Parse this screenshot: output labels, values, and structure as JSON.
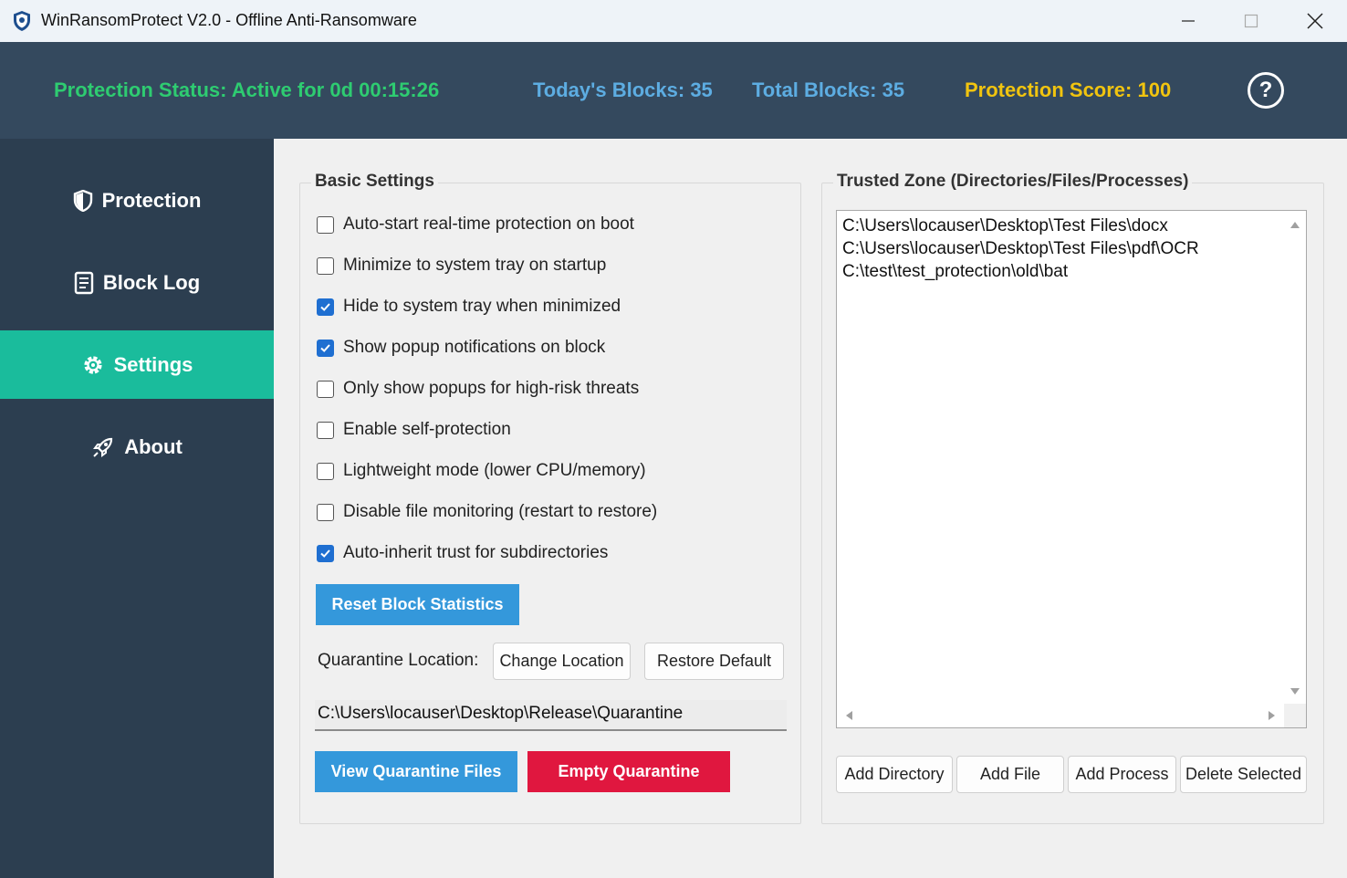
{
  "window": {
    "title": "WinRansomProtect V2.0 - Offline Anti-Ransomware"
  },
  "header": {
    "status": "Protection Status: Active for 0d 00:15:26",
    "today_blocks": "Today's Blocks: 35",
    "total_blocks": "Total Blocks: 35",
    "score": "Protection Score: 100",
    "help": "?",
    "colors": {
      "status": "#2ecc71",
      "blocks": "#5dade2",
      "score": "#f1c40f"
    }
  },
  "sidebar": {
    "items": [
      {
        "label": "Protection",
        "icon": "shield-icon",
        "active": false
      },
      {
        "label": "Block Log",
        "icon": "log-icon",
        "active": false
      },
      {
        "label": "Settings",
        "icon": "gear-icon",
        "active": true
      },
      {
        "label": "About",
        "icon": "rocket-icon",
        "active": false
      }
    ],
    "active_color": "#1abc9c"
  },
  "basic_settings": {
    "title": "Basic Settings",
    "options": [
      {
        "label": "Auto-start real-time protection on boot",
        "checked": false
      },
      {
        "label": "Minimize to system tray on startup",
        "checked": false
      },
      {
        "label": "Hide to system tray when minimized",
        "checked": true
      },
      {
        "label": "Show popup notifications on block",
        "checked": true
      },
      {
        "label": "Only show popups for high-risk threats",
        "checked": false
      },
      {
        "label": "Enable self-protection",
        "checked": false
      },
      {
        "label": "Lightweight mode (lower CPU/memory)",
        "checked": false
      },
      {
        "label": "Disable file monitoring (restart to restore)",
        "checked": false
      },
      {
        "label": "Auto-inherit trust for subdirectories",
        "checked": true
      }
    ],
    "reset_button": "Reset Block Statistics",
    "quarantine_label": "Quarantine Location:",
    "change_location": "Change Location",
    "restore_default": "Restore Default",
    "quarantine_path": "C:\\Users\\locauser\\Desktop\\Release\\Quarantine",
    "view_quarantine": "View Quarantine Files",
    "empty_quarantine": "Empty Quarantine",
    "colors": {
      "primary": "#3498db",
      "danger": "#e0173f"
    }
  },
  "trusted_zone": {
    "title": "Trusted Zone (Directories/Files/Processes)",
    "entries": [
      "C:\\Users\\locauser\\Desktop\\Test Files\\docx",
      "C:\\Users\\locauser\\Desktop\\Test Files\\pdf\\OCR",
      "C:\\test\\test_protection\\old\\bat"
    ],
    "add_directory": "Add Directory",
    "add_file": "Add File",
    "add_process": "Add Process",
    "delete_selected": "Delete Selected"
  }
}
